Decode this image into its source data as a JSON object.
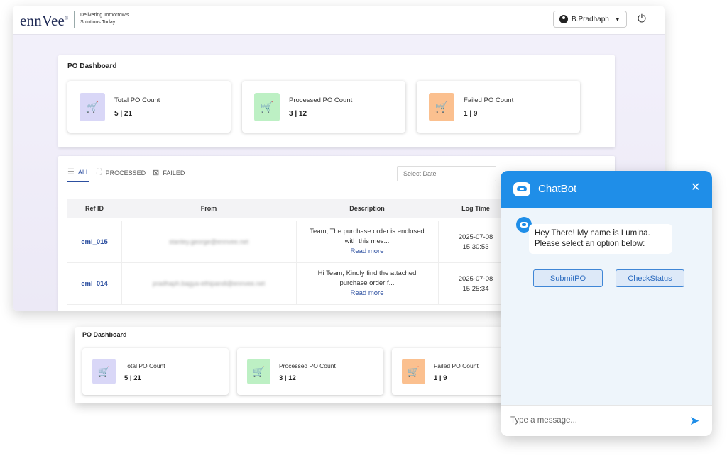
{
  "header": {
    "logo": "ennVee",
    "logo_mark": "®",
    "tagline": "Delivering Tomorrow's Solutions Today",
    "user_name": "B.Pradhaph"
  },
  "dashboard": {
    "title": "PO Dashboard",
    "cards": [
      {
        "label": "Total PO Count",
        "value": "5 | 21",
        "color": "#d9d7f7",
        "icon": "cart-icon"
      },
      {
        "label": "Processed PO Count",
        "value": "3 | 12",
        "color": "#bdf0c4",
        "icon": "cart-check-icon"
      },
      {
        "label": "Failed PO Count",
        "value": "1 | 9",
        "color": "#fbc08f",
        "icon": "cart-x-icon"
      }
    ]
  },
  "filters": {
    "tabs": [
      "ALL",
      "PROCESSED",
      "FAILED"
    ],
    "date_placeholder": "Select Date"
  },
  "table": {
    "columns": [
      "Ref ID",
      "From",
      "Description",
      "Log Time"
    ],
    "rows": [
      {
        "ref": "eml_015",
        "from": "stanley.george@ennvee.net",
        "desc": "Team, The purchase order is enclosed with this mes...",
        "more": "Read more",
        "date": "2025-07-08",
        "time": "15:30:53"
      },
      {
        "ref": "eml_014",
        "from": "pradhaph.bagya-ethipandi@ennvee.net",
        "desc": "Hi Team, Kindly find the attached purchase order f...",
        "more": "Read more",
        "date": "2025-07-08",
        "time": "15:25:34"
      }
    ]
  },
  "chatbot": {
    "title": "ChatBot",
    "greeting": "Hey There! My name is Lumina. Please select an option below:",
    "options": [
      "SubmitPO",
      "CheckStatus"
    ],
    "input_placeholder": "Type a message..."
  }
}
